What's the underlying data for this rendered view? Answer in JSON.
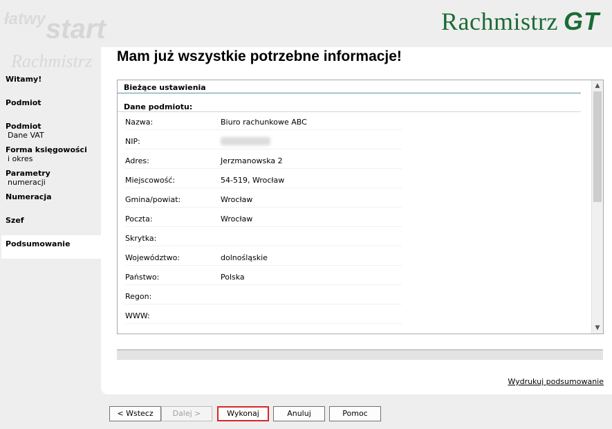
{
  "banner": {
    "watermark_latwy": "łatwy",
    "watermark_start": "start",
    "watermark_product": "Rachmistrz",
    "logo_main": "Rachmistrz",
    "logo_suffix": "GT",
    "logo_color": "#1c6b36"
  },
  "sidebar": {
    "items": [
      {
        "title": "Witamy!",
        "sub": ""
      },
      {
        "title": "Podmiot",
        "sub": ""
      },
      {
        "title": "Podmiot",
        "sub": "Dane VAT"
      },
      {
        "title": "Forma księgowości",
        "sub": "i okres"
      },
      {
        "title": "Parametry",
        "sub": "numeracji"
      },
      {
        "title": "Numeracja",
        "sub": ""
      },
      {
        "title": "Szef",
        "sub": ""
      },
      {
        "title": "Podsumowanie",
        "sub": "",
        "active": true
      }
    ]
  },
  "main": {
    "title": "Mam już wszystkie potrzebne informacje!",
    "section_header": "Bieżące ustawienia",
    "subsection_header": "Dane podmiotu:",
    "rows": [
      {
        "key": "Nazwa:",
        "value": "Biuro rachunkowe ABC"
      },
      {
        "key": "NIP:",
        "value": ""
      },
      {
        "key": "Adres:",
        "value": "Jerzmanowska 2"
      },
      {
        "key": "Miejscowość:",
        "value": "54-519, Wrocław"
      },
      {
        "key": "Gmina/powiat:",
        "value": "Wrocław"
      },
      {
        "key": "Poczta:",
        "value": "Wrocław"
      },
      {
        "key": "Skrytka:",
        "value": ""
      },
      {
        "key": "Województwo:",
        "value": "dolnośląskie"
      },
      {
        "key": "Państwo:",
        "value": "Polska"
      },
      {
        "key": "Regon:",
        "value": ""
      },
      {
        "key": "WWW:",
        "value": ""
      }
    ],
    "print_link": "Wydrukuj podsumowanie"
  },
  "buttons": {
    "back": "< Wstecz",
    "next": "Dalej >",
    "execute": "Wykonaj",
    "cancel": "Anuluj",
    "help": "Pomoc"
  },
  "icons": {
    "scroll_up": "chevron-up-icon",
    "scroll_down": "chevron-down-icon"
  },
  "colors": {
    "accent_highlight": "#d6262b",
    "section_rule": "#5b8fa3"
  }
}
